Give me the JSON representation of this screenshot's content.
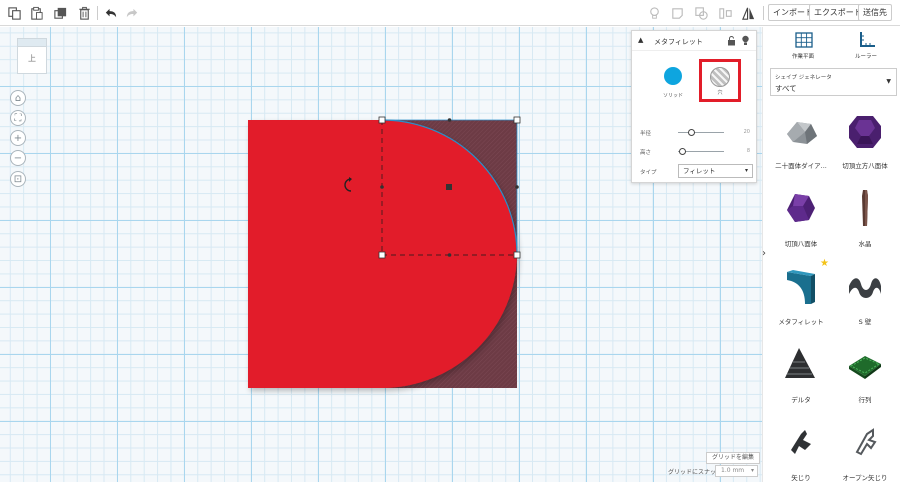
{
  "toolbar": {
    "actions": [
      "copy-icon",
      "paste-icon",
      "duplicate-icon",
      "trash-icon",
      "undo-icon",
      "redo-icon"
    ],
    "view_tools": [
      "lightbulb-icon",
      "note-icon",
      "group-icon",
      "align-icon",
      "mirror-icon"
    ],
    "import_label": "インポート",
    "export_label": "エクスポート",
    "send_label": "送信先"
  },
  "viewcube": {
    "label": "上"
  },
  "nav_controls": [
    "home-icon",
    "fit-icon",
    "zoom-in-icon",
    "zoom-out-icon",
    "ortho-icon"
  ],
  "inspector": {
    "title": "メタフィレット",
    "solid_label": "ソリッド",
    "hole_label": "穴",
    "properties": [
      {
        "name": "半径",
        "value": "20",
        "fraction": 0.3
      },
      {
        "name": "高さ",
        "value": "8",
        "fraction": 0.1
      }
    ],
    "type_label": "タイプ",
    "type_value": "フィレット"
  },
  "workplane": {
    "edit_grid_label": "グリッドを編集",
    "snap_label": "グリッドにスナップ",
    "snap_value": "1.0 mm"
  },
  "panel": {
    "tools": [
      {
        "icon": "workplane-icon",
        "label": "作業平面"
      },
      {
        "icon": "ruler-icon",
        "label": "ルーラー"
      }
    ],
    "library_header": "シェイプ ジェネレータ",
    "library_value": "すべて",
    "shapes": [
      {
        "icon": "icosahedron-icon",
        "label": "二十面体ダイア..."
      },
      {
        "icon": "truncated-cuboctahedron-icon",
        "label": "切頂立方八面体"
      },
      {
        "icon": "truncated-octahedron-icon",
        "label": "切頂八面体"
      },
      {
        "icon": "crystal-icon",
        "label": "水晶"
      },
      {
        "icon": "meta-fillet-icon",
        "label": "メタフィレット",
        "starred": true
      },
      {
        "icon": "s-wall-icon",
        "label": "S 壁"
      },
      {
        "icon": "delta-icon",
        "label": "デルタ"
      },
      {
        "icon": "array-icon",
        "label": "行列"
      },
      {
        "icon": "arrow-icon",
        "label": "矢じり"
      },
      {
        "icon": "open-arrow-icon",
        "label": "オープン矢じり"
      }
    ]
  },
  "colors": {
    "solid": "#e21d29",
    "hole": "#6d3b45",
    "accent": "#0ea5df",
    "highlight": "#e21d29"
  }
}
